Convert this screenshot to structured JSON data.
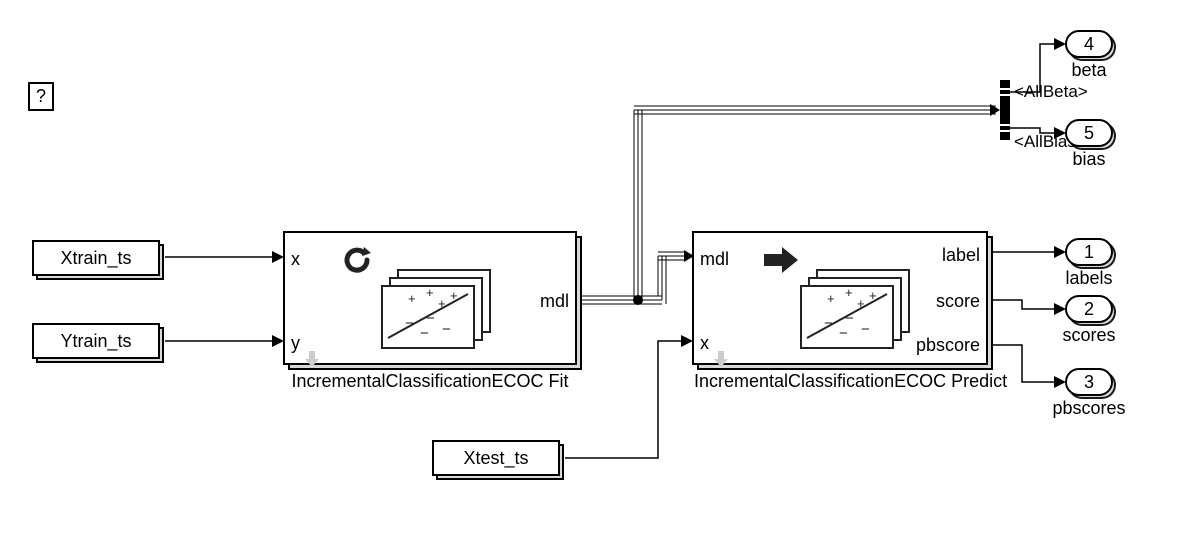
{
  "annotation_label": "?",
  "sources": {
    "xtrain": "Xtrain_ts",
    "ytrain": "Ytrain_ts",
    "xtest": "Xtest_ts"
  },
  "block_fit": {
    "caption": "IncrementalClassificationECOC Fit",
    "ports": {
      "x": "x",
      "y": "y",
      "mdl": "mdl"
    },
    "icons": {
      "refresh": "refresh-icon",
      "classifier": "classifier-icon",
      "update": "down-arrow-icon"
    }
  },
  "block_predict": {
    "caption": "IncrementalClassificationECOC Predict",
    "ports": {
      "mdl": "mdl",
      "x": "x",
      "label": "label",
      "score": "score",
      "pbscore": "pbscore"
    },
    "icons": {
      "arrow_right": "arrow-right-icon",
      "classifier": "classifier-icon",
      "update": "down-arrow-icon"
    }
  },
  "bus_signals": {
    "allbeta": "<AllBeta>",
    "allbias": "<AllBias>"
  },
  "outports": {
    "labels": {
      "num": "1",
      "caption": "labels"
    },
    "scores": {
      "num": "2",
      "caption": "scores"
    },
    "pbscores": {
      "num": "3",
      "caption": "pbscores"
    },
    "beta": {
      "num": "4",
      "caption": "beta"
    },
    "bias": {
      "num": "5",
      "caption": "bias"
    }
  }
}
